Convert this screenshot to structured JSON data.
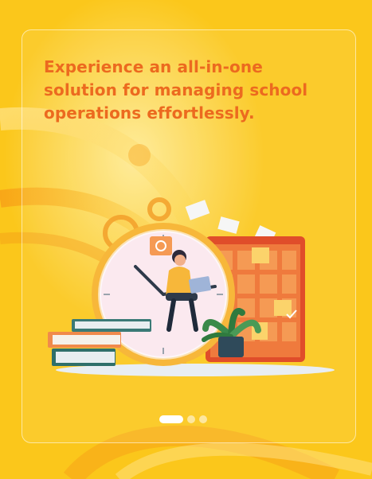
{
  "onboarding": {
    "headline": "Experience an all-in-one solution for managing school operations effortlessly.",
    "illustration_icon": "school-management-illustration",
    "pager": {
      "total": 3,
      "active_index": 0
    }
  },
  "colors": {
    "background": "#fbc71b",
    "headline": "#ec6a1f",
    "dot_active": "#ffffff",
    "dot_inactive": "#fde7a3"
  }
}
